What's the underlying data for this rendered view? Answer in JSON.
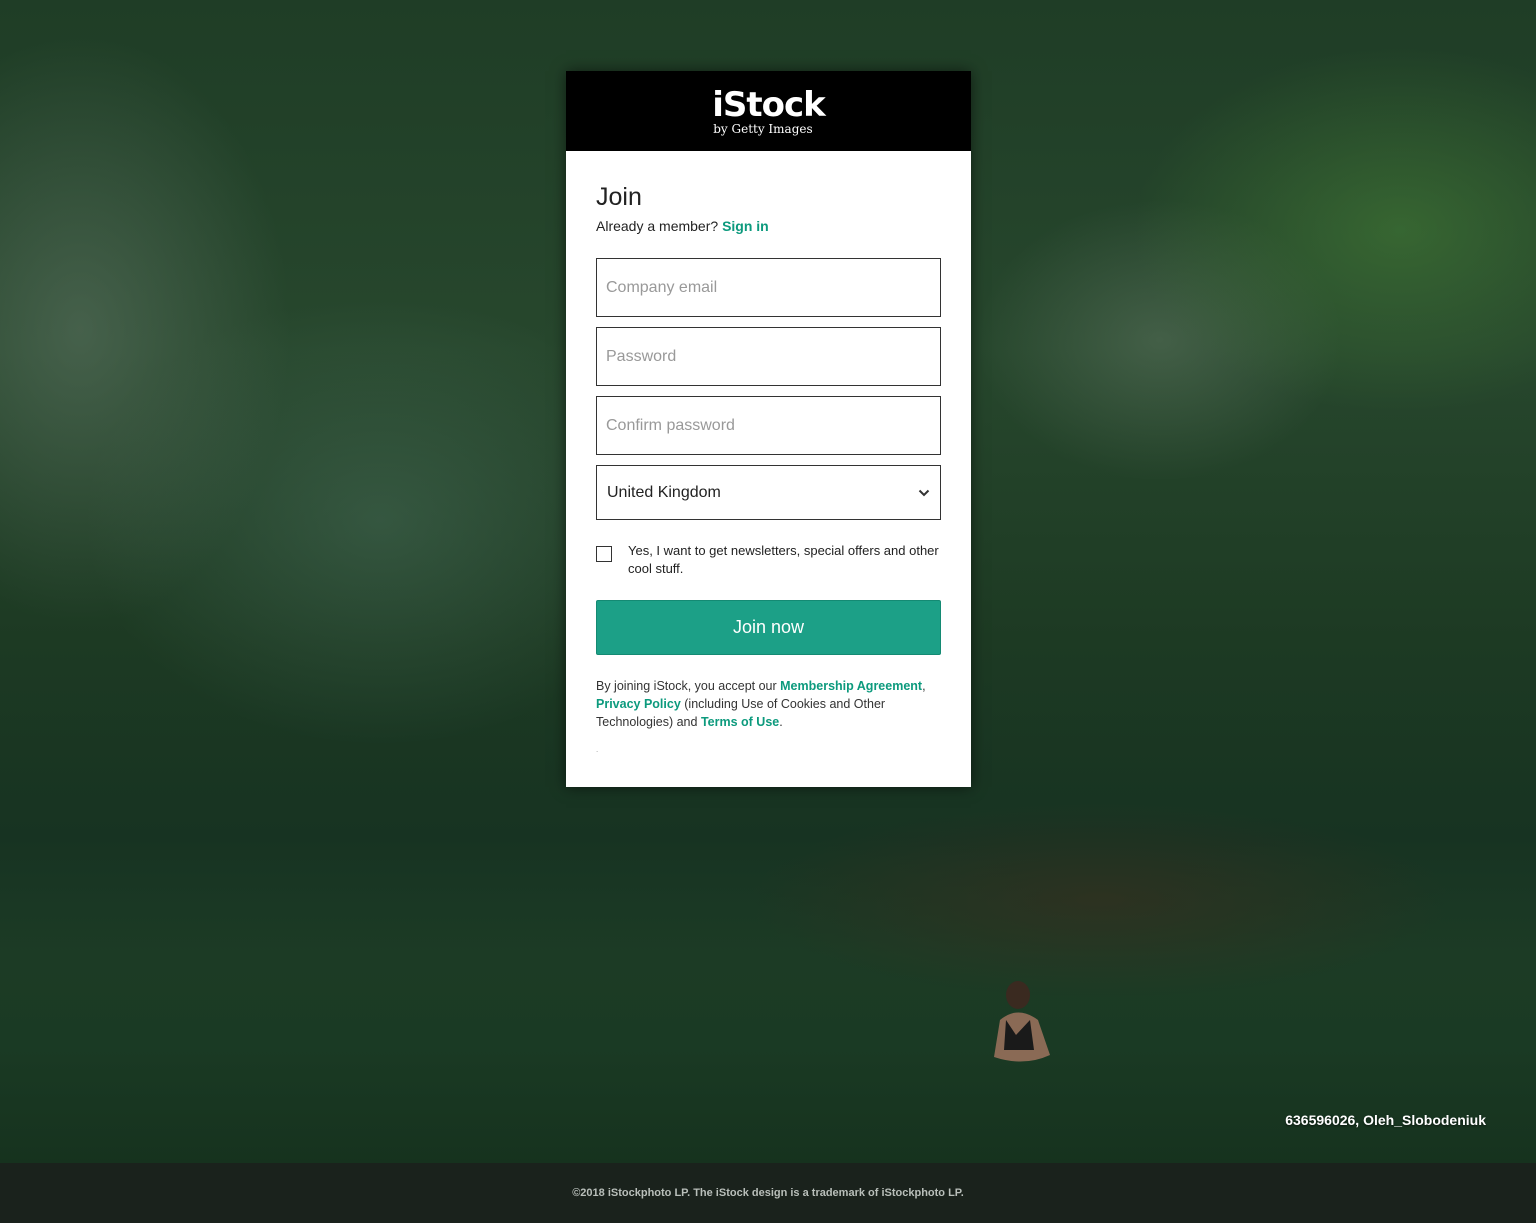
{
  "brand": {
    "name": "iStock",
    "tagline": "by Getty Images"
  },
  "form": {
    "title": "Join",
    "member_prompt": "Already a member?",
    "sign_in_link": "Sign in",
    "email_placeholder": "Company email",
    "password_placeholder": "Password",
    "confirm_password_placeholder": "Confirm password",
    "country_selected": "United Kingdom",
    "newsletter_label": "Yes, I want to get newsletters, special offers and other cool stuff.",
    "newsletter_checked": false,
    "submit_label": "Join now"
  },
  "legal": {
    "prefix": "By joining iStock, you accept our",
    "membership_agreement": "Membership Agreement",
    "comma": ",",
    "privacy_policy": "Privacy Policy",
    "privacy_suffix": "(including Use of Cookies and Other Technologies) and",
    "terms_of_use": "Terms of Use",
    "period": ".",
    "small_mark": "."
  },
  "photo_credit": "636596026, Oleh_Slobodeniuk",
  "footer": {
    "copyright": "©2018 iStockphoto LP. The iStock design is a trademark of iStockphoto LP."
  },
  "colors": {
    "accent": "#1ca087",
    "link": "#0c9a7d",
    "header_bg": "#000000",
    "footer_bg": "#1a221c"
  }
}
